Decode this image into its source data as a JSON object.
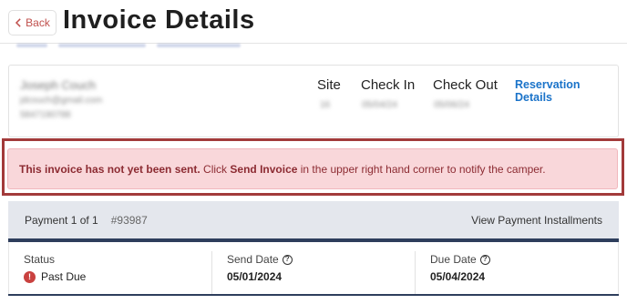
{
  "header": {
    "back_label": "Back",
    "title": "Invoice Details"
  },
  "reservation": {
    "guest_name": "Joseph Couch",
    "guest_email": "jdcouch@gmail.com",
    "guest_phone": "5847190788",
    "site_label": "Site",
    "site_value": "16",
    "checkin_label": "Check In",
    "checkin_value": "05/04/24",
    "checkout_label": "Check Out",
    "checkout_value": "05/06/24",
    "details_link": "Reservation Details"
  },
  "alert": {
    "lead": "This invoice has not yet been sent.",
    "text_1": " Click ",
    "action": "Send Invoice",
    "text_2": " in the upper right hand corner to notify the camper."
  },
  "payment": {
    "label": "Payment 1 of 1",
    "number": "#93987",
    "installments_link": "View Payment Installments",
    "status_label": "Status",
    "status_value": "Past Due",
    "send_date_label": "Send Date",
    "send_date_value": "05/01/2024",
    "due_date_label": "Due Date",
    "due_date_value": "05/04/2024"
  },
  "colors": {
    "accent_link": "#1a73c9",
    "alert_bg": "#f9d7da",
    "alert_text": "#8c2b32",
    "highlight_border": "#a23a3a",
    "rule_navy": "#2e3e5c",
    "past_due": "#c9413f"
  },
  "icons": {
    "back": "chevron-left-icon",
    "help": "question-circle-icon",
    "status": "exclamation-circle-icon"
  }
}
